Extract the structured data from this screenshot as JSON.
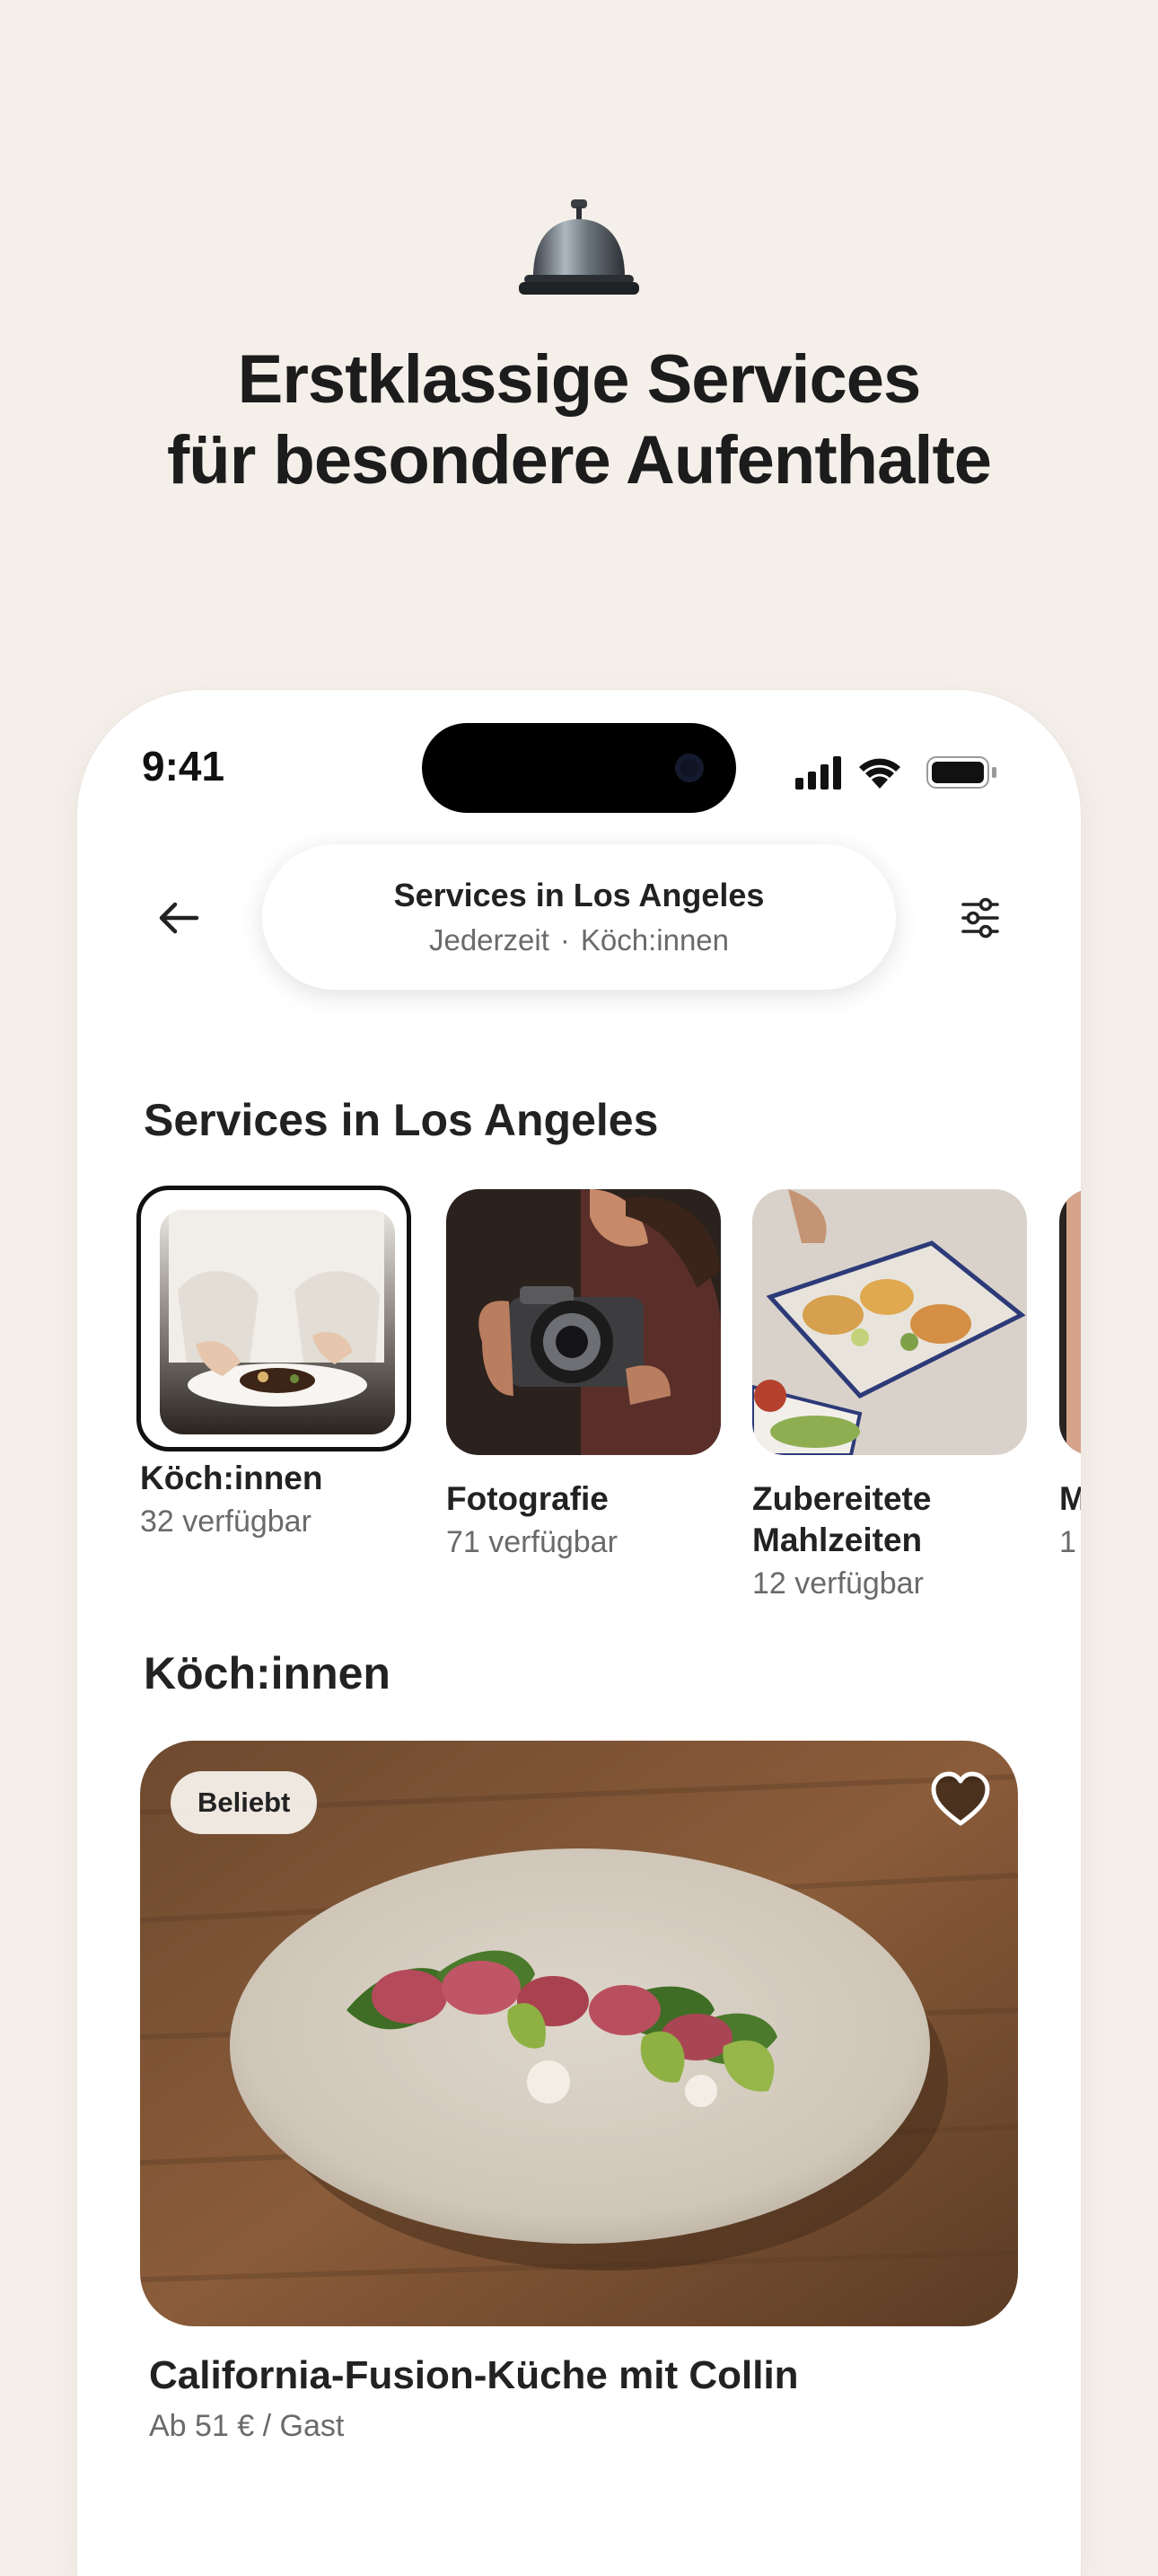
{
  "promo": {
    "icon": "service-bell-icon",
    "headline_line1": "Erstklassige Services",
    "headline_line2": "für besondere Aufenthalte"
  },
  "status_bar": {
    "time": "9:41",
    "icons": [
      "cellular-signal-icon",
      "wifi-icon",
      "battery-icon"
    ]
  },
  "header": {
    "back_icon": "arrow-left-icon",
    "search_title": "Services in Los Angeles",
    "search_when": "Jederzeit",
    "search_separator": "·",
    "search_what": "Köch:innen",
    "filter_icon": "sliders-icon"
  },
  "categories_section": {
    "title": "Services in Los Angeles",
    "items": [
      {
        "label": "Köch:innen",
        "count": "32 verfügbar",
        "selected": true
      },
      {
        "label": "Fotografie",
        "count": "71 verfügbar",
        "selected": false
      },
      {
        "label": "Zubereitete Mahlzeiten",
        "count": "12 verfügbar",
        "selected": false
      },
      {
        "label": "M",
        "count": "1",
        "selected": false
      }
    ]
  },
  "listings_section": {
    "title": "Köch:innen",
    "listing": {
      "badge": "Beliebt",
      "favorite_icon": "heart-icon",
      "title": "California-Fusion-Küche mit Collin",
      "price": "Ab 51 € / Gast"
    }
  },
  "colors": {
    "page_background": "#f4efe9",
    "text_primary": "#222222",
    "text_secondary": "#6a6a6a",
    "card_background": "#ffffff"
  }
}
